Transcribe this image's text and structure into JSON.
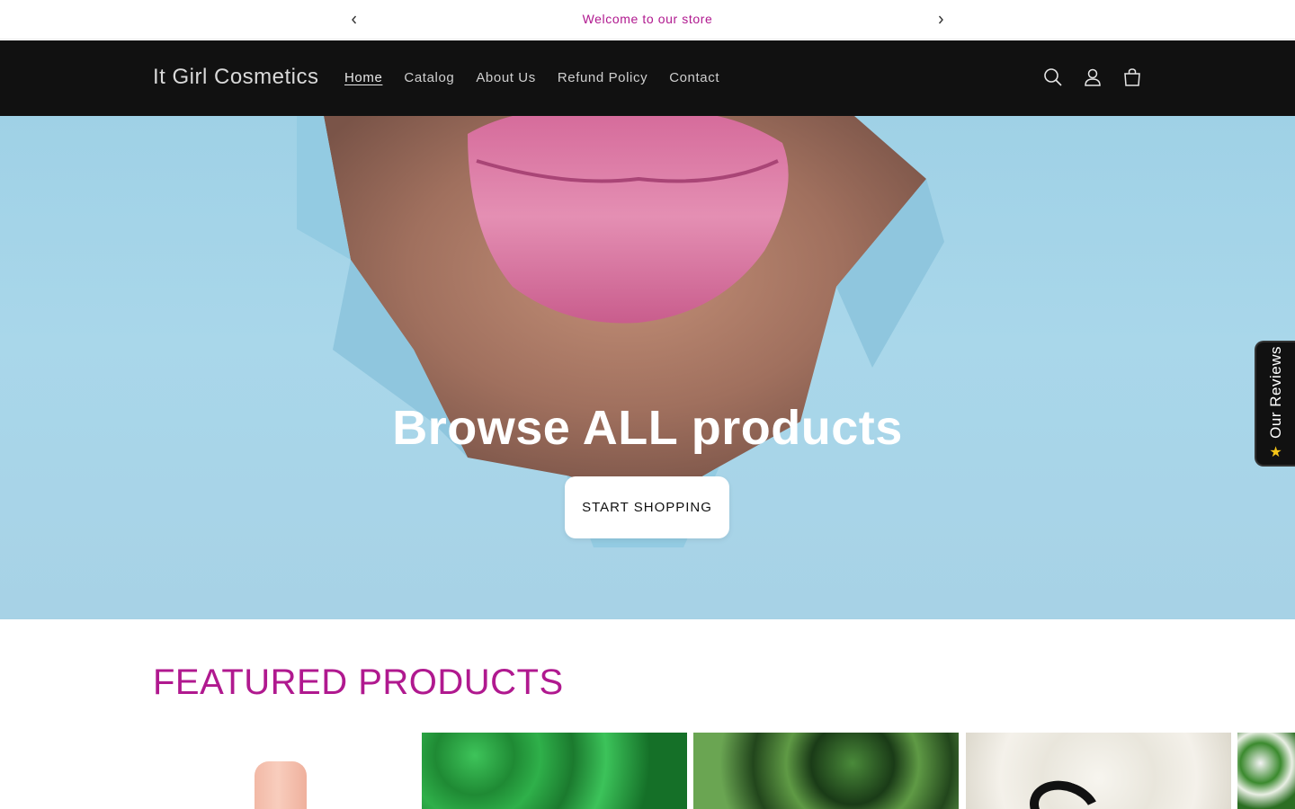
{
  "announcement": {
    "message": "Welcome to our store",
    "color": "#b0198f"
  },
  "header": {
    "logo": "It Girl Cosmetics",
    "nav": [
      "Home",
      "Catalog",
      "About Us",
      "Refund Policy",
      "Contact"
    ],
    "active_nav": "Home",
    "icons": [
      "search-icon",
      "account-icon",
      "cart-icon"
    ]
  },
  "hero": {
    "title": "Browse ALL products",
    "button_label": "START SHOPPING"
  },
  "reviews_tab": {
    "label": "Our Reviews",
    "icon": "star-icon"
  },
  "featured": {
    "title": "FEATURED PRODUCTS",
    "color": "#b0198f"
  }
}
